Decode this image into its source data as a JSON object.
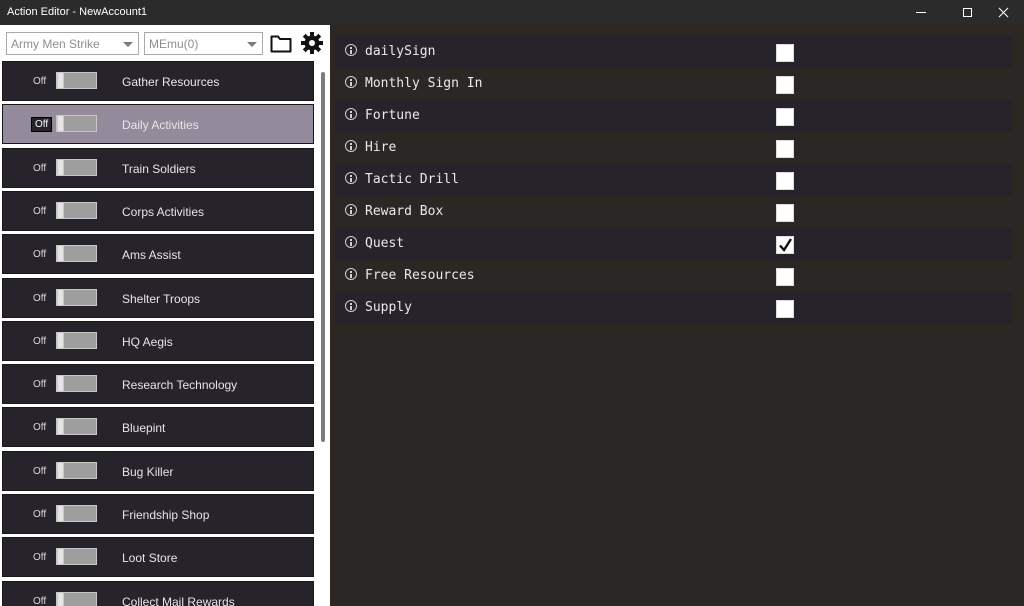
{
  "window": {
    "title": "Action Editor - NewAccount1"
  },
  "toolbar": {
    "game_select": {
      "value": "Army Men Strike"
    },
    "emulator_select": {
      "value": "MEmu(0)"
    },
    "folder_icon": "folder-icon",
    "settings_icon": "gear-icon"
  },
  "actions": [
    {
      "label": "Gather Resources",
      "toggle": "Off",
      "selected": false
    },
    {
      "label": "Daily Activities",
      "toggle": "Off",
      "selected": true
    },
    {
      "label": "Train Soldiers",
      "toggle": "Off",
      "selected": false
    },
    {
      "label": "Corps Activities",
      "toggle": "Off",
      "selected": false
    },
    {
      "label": "Ams Assist",
      "toggle": "Off",
      "selected": false
    },
    {
      "label": "Shelter Troops",
      "toggle": "Off",
      "selected": false
    },
    {
      "label": "HQ Aegis",
      "toggle": "Off",
      "selected": false
    },
    {
      "label": "Research Technology",
      "toggle": "Off",
      "selected": false
    },
    {
      "label": "Bluepint",
      "toggle": "Off",
      "selected": false
    },
    {
      "label": "Bug Killer",
      "toggle": "Off",
      "selected": false
    },
    {
      "label": "Friendship Shop",
      "toggle": "Off",
      "selected": false
    },
    {
      "label": "Loot Store",
      "toggle": "Off",
      "selected": false
    },
    {
      "label": "Collect Mail Rewards",
      "toggle": "Off",
      "selected": false
    }
  ],
  "options": [
    {
      "label": "dailySign",
      "checked": false
    },
    {
      "label": "Monthly Sign In",
      "checked": false
    },
    {
      "label": "Fortune",
      "checked": false
    },
    {
      "label": "Hire",
      "checked": false
    },
    {
      "label": "Tactic Drill",
      "checked": false
    },
    {
      "label": "Reward Box",
      "checked": false
    },
    {
      "label": "Quest",
      "checked": true
    },
    {
      "label": "Free Resources",
      "checked": false
    },
    {
      "label": "Supply",
      "checked": false
    }
  ],
  "colors": {
    "background": "#2b2725",
    "list_item": "#27232a",
    "selected_item": "#938a9c",
    "titlebar": "#2b2b2b"
  }
}
